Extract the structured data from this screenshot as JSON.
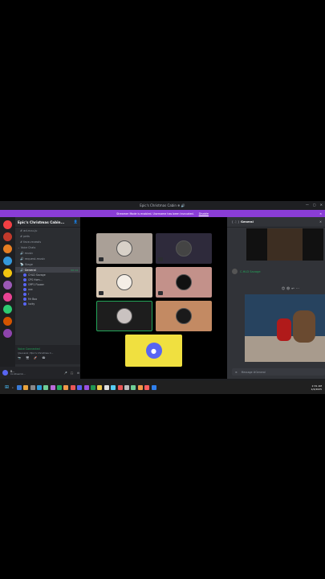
{
  "window": {
    "title": "Epic's Christmas Cabin ❄ 🔊"
  },
  "banner": {
    "text": "Streamer Mode is enabled. Username has been truncated.",
    "action": "Disable"
  },
  "server": {
    "name": "Epic's Christmas Cabin..."
  },
  "channels": [
    {
      "label": "ad-nuu-ju",
      "active": false
    },
    {
      "label": "pets",
      "active": false
    },
    {
      "label": "face-reveals",
      "active": false
    }
  ],
  "category_voice": "Voice Chats",
  "voice_channels": [
    {
      "label": "music"
    },
    {
      "label": "request-music"
    }
  ],
  "stage_label": "Stage",
  "general_channel": {
    "label": "General",
    "time": "00:14"
  },
  "voice_users": [
    "CHLD Savage",
    "CPS Hom...",
    "OPP1 Flower",
    "xxx",
    "f",
    "Mr Boo",
    "lucky"
  ],
  "voice_status": {
    "title": "Voice Connected",
    "sub": "(|General / Epic's Christmas C..."
  },
  "user": {
    "name": "B...",
    "sub": "Co-Streamin..."
  },
  "chat": {
    "channel": "General",
    "author": "C.HLD Savage",
    "input_placeholder": "Message #General"
  },
  "taskbar": {
    "time": "2:31 AM",
    "date": "1/4/2025"
  },
  "colors": {
    "accent": "#5865f2",
    "banner": "#8a3dd6",
    "golden_tile": "#f0e040"
  }
}
